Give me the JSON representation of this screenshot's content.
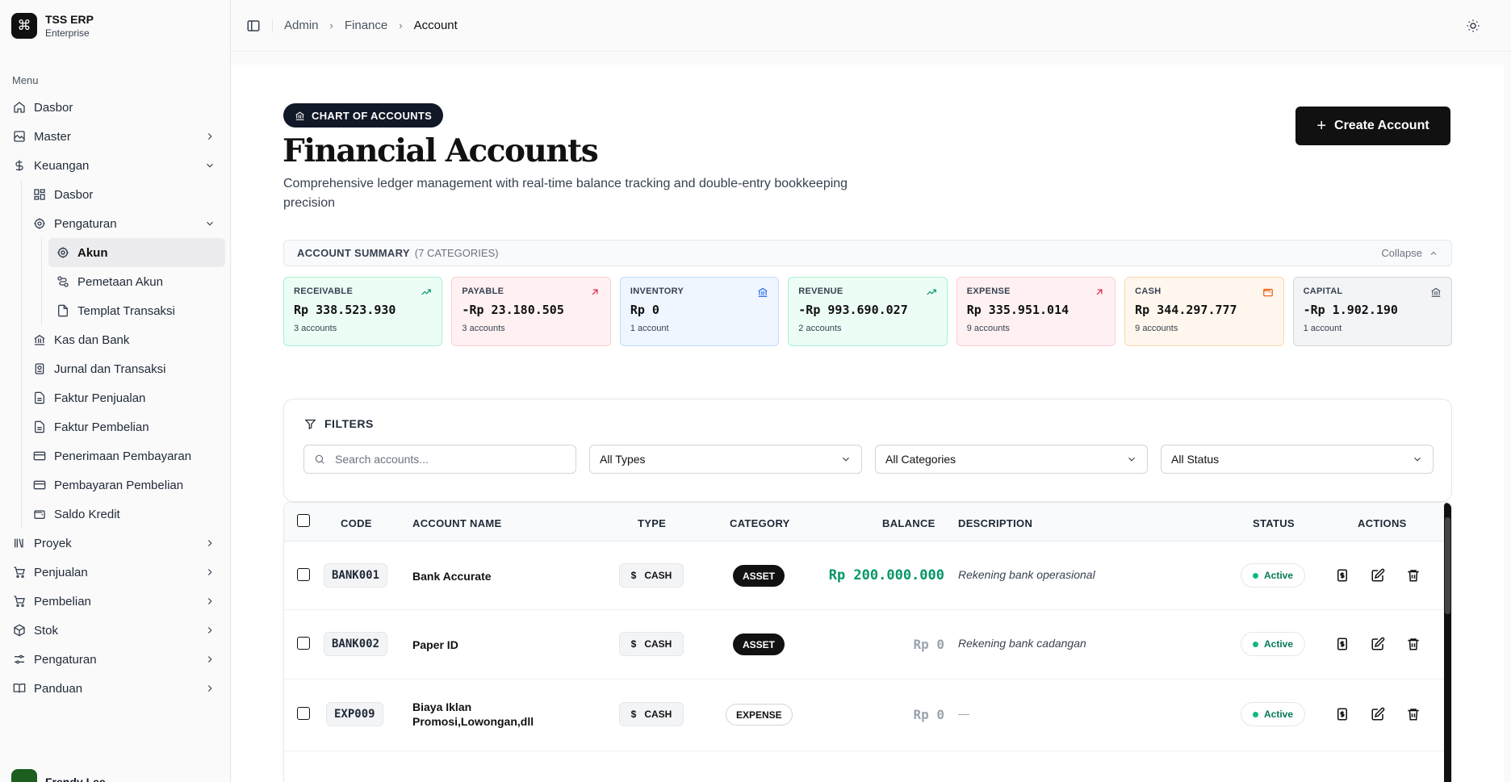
{
  "app": {
    "name": "TSS ERP",
    "plan": "Enterprise",
    "logo_glyph": "⌘"
  },
  "sidebar": {
    "menu_label": "Menu",
    "items": [
      {
        "label": "Dasbor",
        "icon": "home-icon"
      },
      {
        "label": "Master",
        "icon": "image-icon"
      },
      {
        "label": "Keuangan",
        "icon": "dollar-icon"
      },
      {
        "label": "Dasbor",
        "icon": "grid-icon"
      },
      {
        "label": "Pengaturan",
        "icon": "gear-icon"
      },
      {
        "label": "Akun",
        "icon": "gear-icon"
      },
      {
        "label": "Pemetaan Akun",
        "icon": "map-icon"
      },
      {
        "label": "Templat Transaksi",
        "icon": "file-icon"
      },
      {
        "label": "Kas dan Bank",
        "icon": "bank-icon"
      },
      {
        "label": "Jurnal dan Transaksi",
        "icon": "book-icon"
      },
      {
        "label": "Faktur Penjualan",
        "icon": "document-icon"
      },
      {
        "label": "Faktur Pembelian",
        "icon": "document-icon"
      },
      {
        "label": "Penerimaan Pembayaran",
        "icon": "card-icon"
      },
      {
        "label": "Pembayaran Pembelian",
        "icon": "card-icon"
      },
      {
        "label": "Saldo Kredit",
        "icon": "wallet-icon"
      },
      {
        "label": "Proyek",
        "icon": "library-icon"
      },
      {
        "label": "Penjualan",
        "icon": "cart-icon"
      },
      {
        "label": "Pembelian",
        "icon": "cart-icon"
      },
      {
        "label": "Stok",
        "icon": "box-icon"
      },
      {
        "label": "Pengaturan",
        "icon": "sliders-icon"
      },
      {
        "label": "Panduan",
        "icon": "book-open-icon"
      }
    ],
    "user": {
      "name": "Frendy Lee"
    }
  },
  "breadcrumb": [
    "Admin",
    "Finance",
    "Account"
  ],
  "header": {
    "pill": "CHART OF ACCOUNTS",
    "title": "Financial Accounts",
    "description": "Comprehensive ledger management with real-time balance tracking and double-entry bookkeeping precision",
    "create_button": "Create Account"
  },
  "summary": {
    "label": "ACCOUNT SUMMARY",
    "count": "(7 CATEGORIES)",
    "collapse": "Collapse",
    "cards": [
      {
        "title": "RECEIVABLE",
        "value": "Rp 338.523.930",
        "count": "3 accounts",
        "icon": "trend-up-icon",
        "bg": "#ecfdf5",
        "border": "#a7f3d0",
        "icon_color": "#059669"
      },
      {
        "title": "PAYABLE",
        "value": "-Rp 23.180.505",
        "count": "3 accounts",
        "icon": "arrow-up-right-icon",
        "bg": "#fff1f2",
        "border": "#fecdd3",
        "icon_color": "#e11d48"
      },
      {
        "title": "INVENTORY",
        "value": "Rp 0",
        "count": "1 account",
        "icon": "bank-icon",
        "bg": "#eff6ff",
        "border": "#bfdbfe",
        "icon_color": "#2563eb"
      },
      {
        "title": "REVENUE",
        "value": "-Rp 993.690.027",
        "count": "2 accounts",
        "icon": "trend-up-icon",
        "bg": "#ecfdf5",
        "border": "#a7f3d0",
        "icon_color": "#059669"
      },
      {
        "title": "EXPENSE",
        "value": "Rp 335.951.014",
        "count": "9 accounts",
        "icon": "arrow-up-right-icon",
        "bg": "#fff1f2",
        "border": "#fecdd3",
        "icon_color": "#e11d48"
      },
      {
        "title": "CASH",
        "value": "Rp 344.297.777",
        "count": "9 accounts",
        "icon": "wallet-icon",
        "bg": "#fff7ed",
        "border": "#fed7aa",
        "icon_color": "#ea580c"
      },
      {
        "title": "CAPITAL",
        "value": "-Rp 1.902.190",
        "count": "1 account",
        "icon": "bank-icon",
        "bg": "#f3f4f6",
        "border": "#d1d5db",
        "icon_color": "#4b5563"
      }
    ]
  },
  "filters": {
    "title": "FILTERS",
    "search_placeholder": "Search accounts...",
    "type": "All Types",
    "category": "All Categories",
    "status": "All Status"
  },
  "table": {
    "columns": [
      "CODE",
      "ACCOUNT NAME",
      "TYPE",
      "CATEGORY",
      "BALANCE",
      "DESCRIPTION",
      "STATUS",
      "ACTIONS"
    ],
    "rows": [
      {
        "code": "BANK001",
        "name": "Bank Accurate",
        "type": "CASH",
        "category": "ASSET",
        "balance": "Rp 200.000.000",
        "description": "Rekening bank operasional",
        "status": "Active"
      },
      {
        "code": "BANK002",
        "name": "Paper ID",
        "type": "CASH",
        "category": "ASSET",
        "balance": "Rp 0",
        "description": "Rekening bank cadangan",
        "status": "Active"
      },
      {
        "code": "EXP009",
        "name": "Biaya Iklan Promosi,Lowongan,dll",
        "type": "CASH",
        "category": "EXPENSE",
        "balance": "Rp 0",
        "description": "—",
        "status": "Active"
      }
    ]
  }
}
